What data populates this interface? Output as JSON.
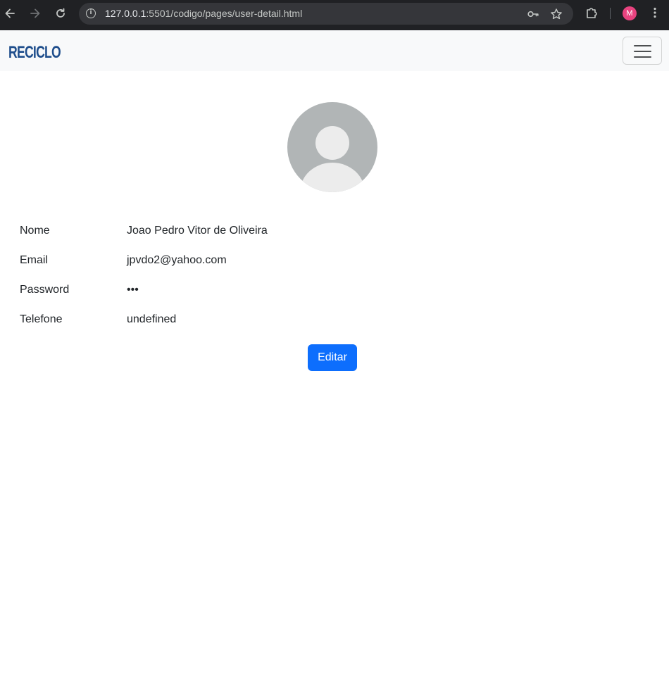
{
  "browser": {
    "url_host": "127.0.0.1",
    "url_path": ":5501/codigo/pages/user-detail.html",
    "profile_initial": "M",
    "icons": {
      "back": "arrow-left-icon",
      "forward": "arrow-right-icon",
      "reload": "reload-icon",
      "site_info": "info-icon",
      "password": "key-icon",
      "bookmark": "star-icon",
      "extensions": "puzzle-icon",
      "menu": "kebab-menu-icon"
    }
  },
  "navbar": {
    "logo_text": "RECICLO",
    "logo_color": "#1f4e8c",
    "toggler_icon": "hamburger-icon"
  },
  "profile": {
    "avatar_icon": "default-user-avatar-icon",
    "fields": [
      {
        "label": "Nome",
        "value": "Joao Pedro Vitor de Oliveira"
      },
      {
        "label": "Email",
        "value": "jpvdo2@yahoo.com"
      },
      {
        "label": "Password",
        "value": "•••"
      },
      {
        "label": "Telefone",
        "value": "undefined"
      }
    ],
    "edit_button_label": "Editar",
    "accent_color": "#0d6efd"
  }
}
